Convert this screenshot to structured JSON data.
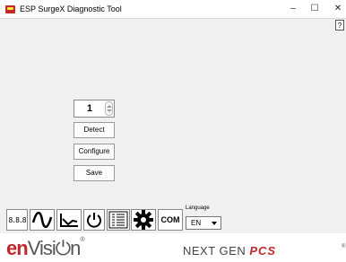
{
  "window": {
    "title": "ESP SurgeX Diagnostic Tool",
    "minimize": "–",
    "maximize": "☐",
    "close": "✕",
    "help": "?"
  },
  "panel": {
    "unit_number": "1",
    "detect_label": "Detect",
    "configure_label": "Configure",
    "save_label": "Save"
  },
  "toolbar": {
    "display_label": "8.8.8",
    "com_label": "COM",
    "icons": [
      "digits-icon",
      "sine-wave-icon",
      "trend-chart-icon",
      "power-icon",
      "list-icon",
      "gear-icon",
      "com-port-icon"
    ]
  },
  "language": {
    "label": "Language",
    "selected": "EN"
  },
  "branding": {
    "envision_a": "en",
    "envision_b": "Visi",
    "envision_c": "n",
    "registered": "®",
    "nextgen": "NEXT GEN",
    "pcs": "PCS",
    "colors": {
      "brand_red": "#c1282d"
    }
  }
}
